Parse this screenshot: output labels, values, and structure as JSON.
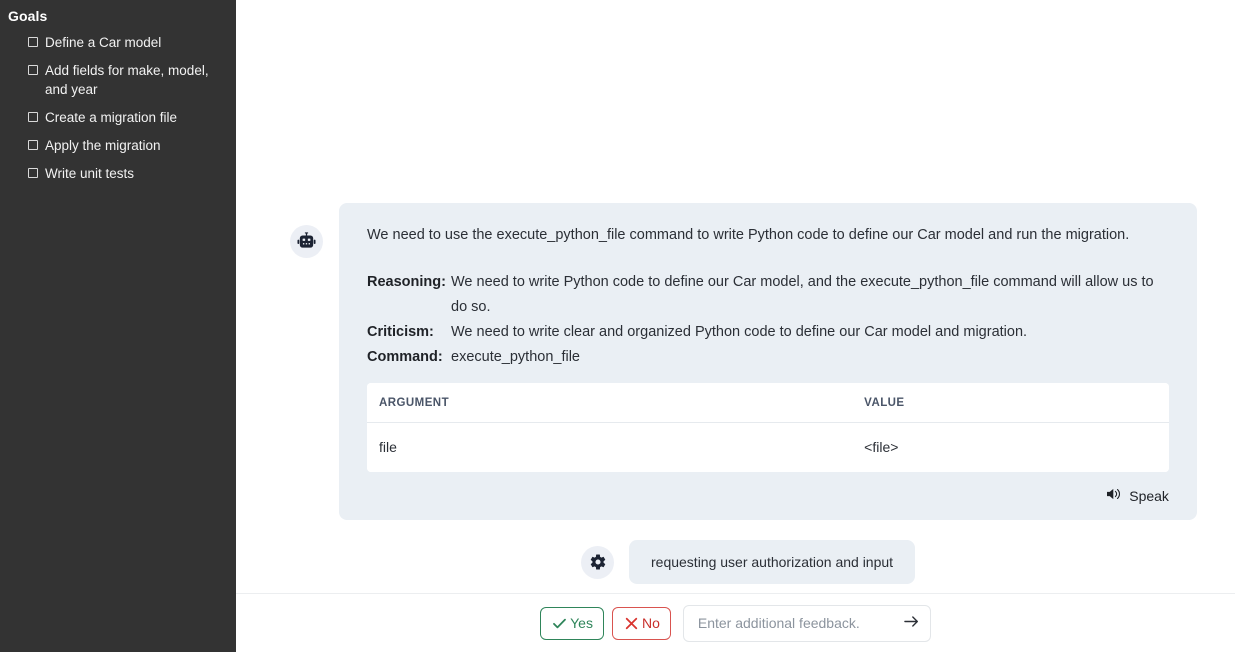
{
  "sidebar": {
    "title": "Goals",
    "goals": [
      {
        "label": "Define a Car model",
        "checked": false
      },
      {
        "label": "Add fields for make, model, and year",
        "checked": false
      },
      {
        "label": "Create a migration file",
        "checked": false
      },
      {
        "label": "Apply the migration",
        "checked": false
      },
      {
        "label": "Write unit tests",
        "checked": false
      }
    ]
  },
  "assistant_message": {
    "avatar_icon": "robot-icon",
    "paragraph": "We need to use the execute_python_file command to write Python code to define our Car model and run the migration.",
    "fields": [
      {
        "key": "Reasoning:",
        "value": "We need to write Python code to define our Car model, and the execute_python_file command will allow us to do so."
      },
      {
        "key": "Criticism:",
        "value": "We need to write clear and organized Python code to define our Car model and migration."
      },
      {
        "key": "Command:",
        "value": "execute_python_file"
      }
    ],
    "table": {
      "headers": [
        "ARGUMENT",
        "VALUE"
      ],
      "rows": [
        {
          "argument": "file",
          "value": "<file>"
        }
      ]
    },
    "speak_label": "Speak",
    "speak_icon": "speaker-icon"
  },
  "system_message": {
    "avatar_icon": "gear-icon",
    "text": "requesting user authorization and input"
  },
  "bottom_bar": {
    "yes_label": "Yes",
    "yes_icon": "check-icon",
    "no_label": "No",
    "no_icon": "x-icon",
    "feedback_placeholder": "Enter additional feedback.",
    "feedback_value": "",
    "send_icon": "arrow-right-icon"
  },
  "colors": {
    "sidebar_bg": "#333333",
    "card_bg": "#eaeff4",
    "avatar_bg": "#eceff5",
    "yes_green": "#2f855a",
    "no_red": "#c9302c",
    "main_bg": "#ffffff"
  }
}
